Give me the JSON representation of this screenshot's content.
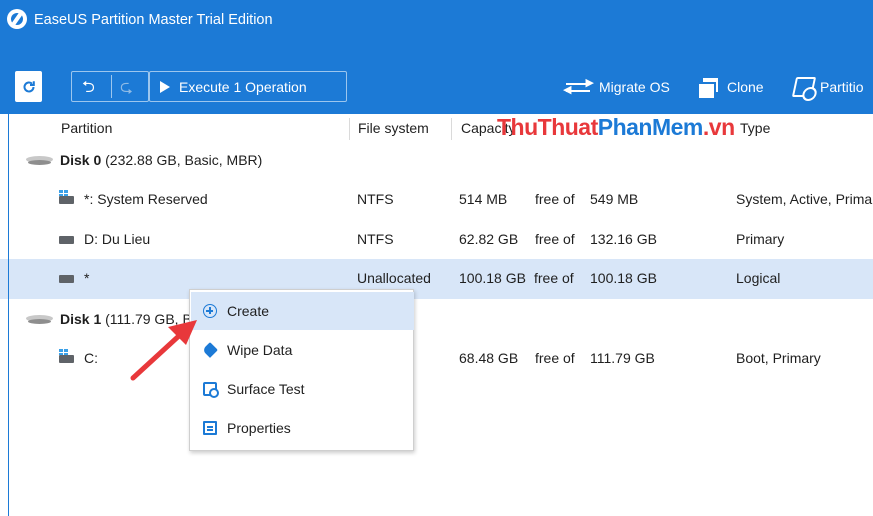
{
  "window": {
    "title": "EaseUS Partition Master Trial Edition"
  },
  "toolbar": {
    "refresh_icon": "refresh-icon",
    "undo_icon": "undo-icon",
    "redo_icon": "redo-icon",
    "execute_label": "Execute 1 Operation",
    "migrate_label": "Migrate OS",
    "clone_label": "Clone",
    "partition_label": "Partitio"
  },
  "columns": {
    "partition": "Partition",
    "file_system": "File system",
    "capacity": "Capacity",
    "type": "Type"
  },
  "watermark": {
    "part1": "ThuThuat",
    "part2": "PhanMem",
    "part3": ".vn"
  },
  "disks": [
    {
      "name": "Disk 0",
      "info": "(232.88 GB, Basic, MBR)",
      "partitions": [
        {
          "name": "*: System Reserved",
          "fs": "NTFS",
          "used": "514 MB",
          "free_of": "free of",
          "total": "549 MB",
          "type": "System, Active, Prima"
        },
        {
          "name": "D: Du Lieu",
          "fs": "NTFS",
          "used": "62.82 GB",
          "free_of": "free of",
          "total": "132.16 GB",
          "type": "Primary"
        },
        {
          "name": "*",
          "fs": "Unallocated",
          "used": "100.18 GB",
          "free_of": "free of",
          "total": "100.18 GB",
          "type": "Logical",
          "selected": true
        }
      ]
    },
    {
      "name": "Disk 1",
      "info": "(111.79 GB, B",
      "partitions": [
        {
          "name": "C:",
          "fs": "",
          "used": "68.48 GB",
          "free_of": "free of",
          "total": "111.79 GB",
          "type": "Boot, Primary"
        }
      ]
    }
  ],
  "context_menu": {
    "items": [
      {
        "label": "Create",
        "icon": "create-icon"
      },
      {
        "label": "Wipe Data",
        "icon": "wipe-icon"
      },
      {
        "label": "Surface Test",
        "icon": "surface-test-icon"
      },
      {
        "label": "Properties",
        "icon": "properties-icon"
      }
    ]
  },
  "colors": {
    "accent": "#1c7ad6",
    "selection": "#d8e6f8",
    "arrow": "#e8383b"
  }
}
